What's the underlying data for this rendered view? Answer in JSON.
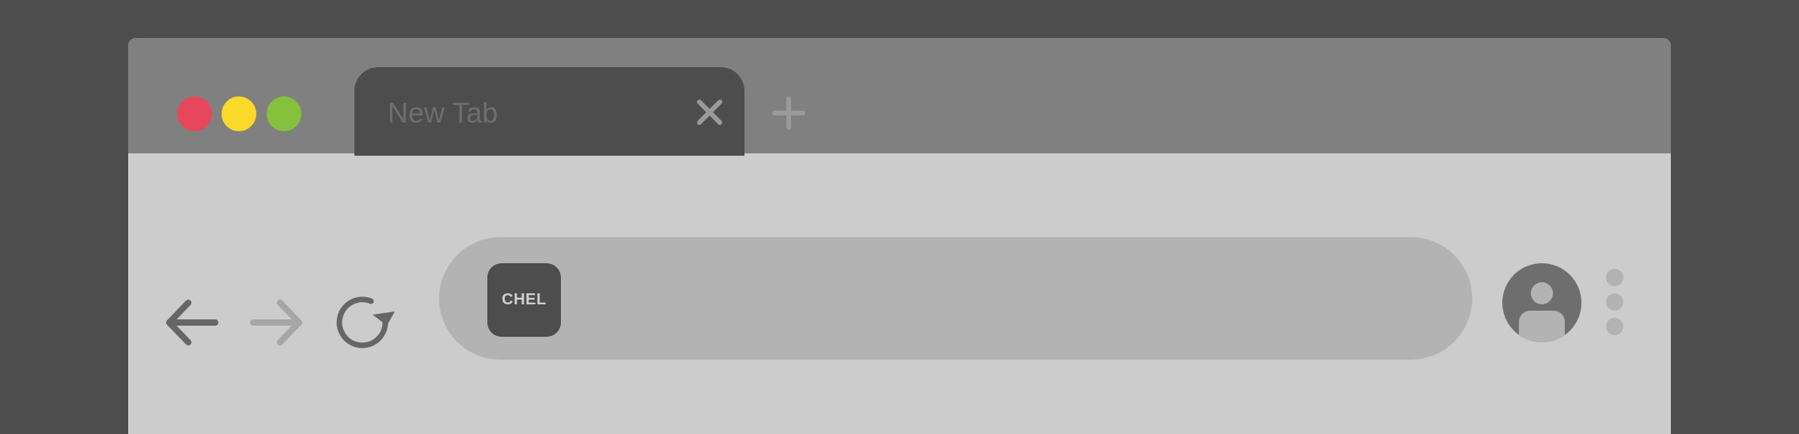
{
  "tab": {
    "title": "New Tab",
    "close_icon": "close-icon"
  },
  "toolbar": {
    "new_tab_icon": "plus-icon",
    "back_icon": "arrow-left-icon",
    "forward_icon": "arrow-right-icon",
    "reload_icon": "reload-icon",
    "profile_icon": "user-icon",
    "menu_icon": "more-vertical-icon"
  },
  "omnibox": {
    "favicon_text": "CHEL"
  },
  "colors": {
    "background": "#4d4d4d",
    "titlebar": "#808080",
    "toolbar": "#cccccc",
    "omnibox": "#b3b3b3",
    "close_red": "#e8475b",
    "minimize_yellow": "#fbd92b",
    "maximize_green": "#86c13d"
  }
}
